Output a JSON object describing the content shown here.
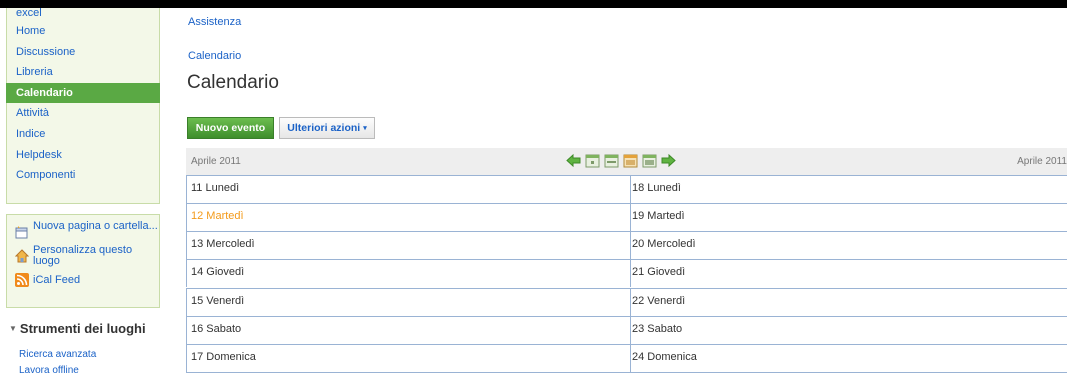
{
  "sidebar": {
    "items": [
      {
        "label": "excel"
      },
      {
        "label": "Home"
      },
      {
        "label": "Discussione"
      },
      {
        "label": "Libreria"
      },
      {
        "label": "Calendario",
        "active": true
      },
      {
        "label": "Attività"
      },
      {
        "label": "Indice"
      },
      {
        "label": "Helpdesk"
      },
      {
        "label": "Componenti"
      }
    ],
    "actions": [
      {
        "label": "Nuova pagina o cartella...",
        "icon": "new-page-icon"
      },
      {
        "label": "Personalizza questo luogo",
        "icon": "customize-icon"
      },
      {
        "label": "iCal Feed",
        "icon": "rss-icon"
      }
    ],
    "tools_title": "Strumenti dei luoghi",
    "tools": [
      {
        "label": "Ricerca avanzata"
      },
      {
        "label": "Lavora offline"
      }
    ]
  },
  "breadcrumb": {
    "level1": "Assistenza",
    "level2": "Calendario"
  },
  "page_title": "Calendario",
  "toolbar": {
    "new_event": "Nuovo evento",
    "more_actions": "Ulteriori azioni",
    "more_caret": "▾"
  },
  "calendar": {
    "month_left": "Aprile 2011",
    "month_right": "Aprile 2011",
    "nav_icons": [
      "prev-arrow-icon",
      "day-view-icon",
      "week-view-icon",
      "month-view-icon",
      "list-view-icon",
      "next-arrow-icon"
    ],
    "week1": [
      {
        "label": "11 Lunedì"
      },
      {
        "label": "12 Martedì",
        "today": true
      },
      {
        "label": "13 Mercoledì"
      },
      {
        "label": "14 Giovedì"
      },
      {
        "label": "15 Venerdì"
      },
      {
        "label": "16 Sabato"
      },
      {
        "label": "17 Domenica"
      }
    ],
    "week2": [
      {
        "label": "18 Lunedì"
      },
      {
        "label": "19 Martedì"
      },
      {
        "label": "20 Mercoledì"
      },
      {
        "label": "21 Giovedì"
      },
      {
        "label": "22 Venerdì"
      },
      {
        "label": "23 Sabato"
      },
      {
        "label": "24 Domenica"
      }
    ]
  },
  "colors": {
    "accent_green": "#5aa944",
    "link_blue": "#1b62c7",
    "today_orange": "#f39a1a",
    "grid_line": "#9ab3d4"
  }
}
